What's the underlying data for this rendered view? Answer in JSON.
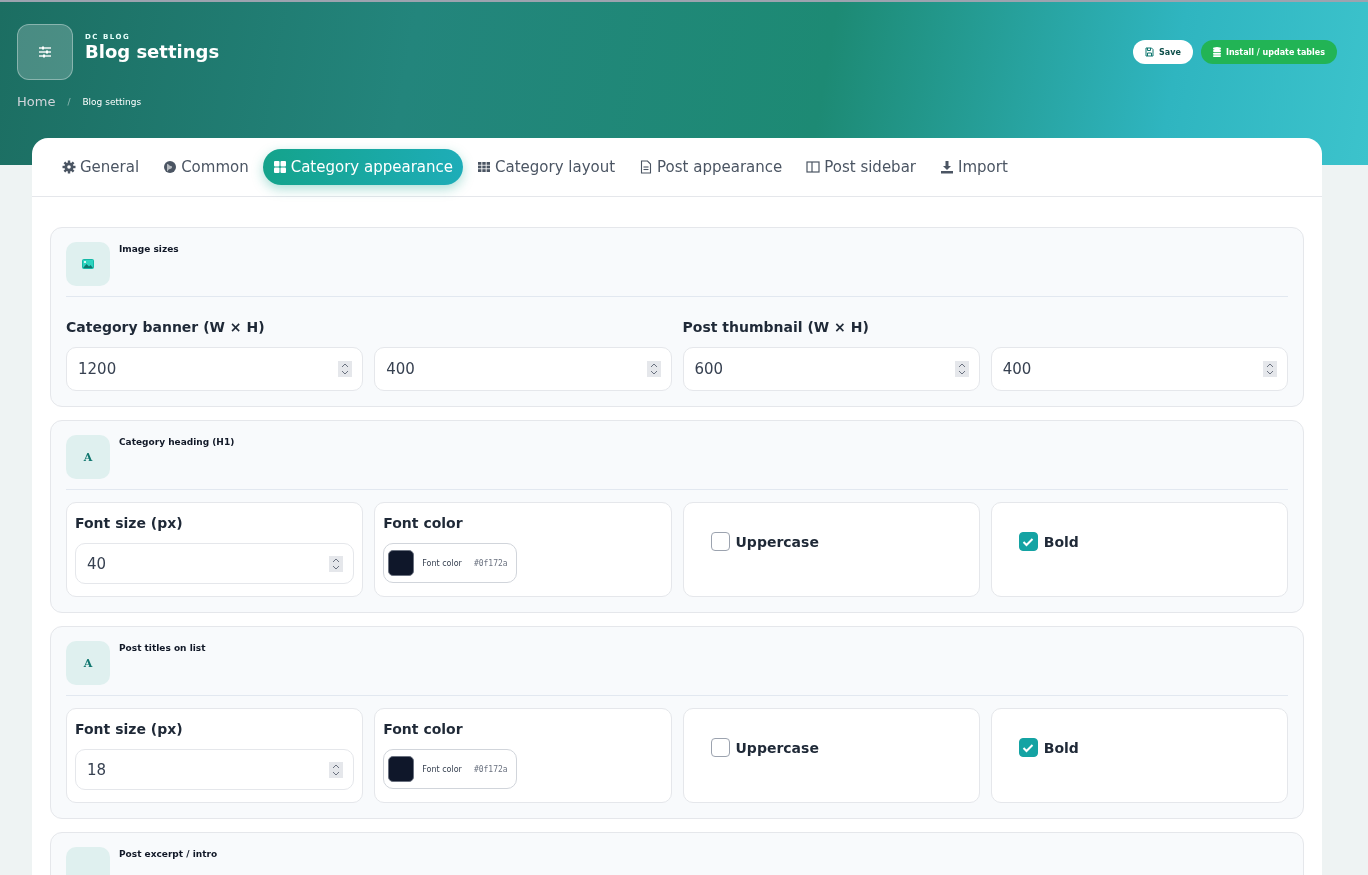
{
  "header": {
    "eyebrow": "DC BLOG",
    "title": "Blog settings",
    "breadcrumb": [
      "Home",
      "Blog settings"
    ],
    "breadcrumb_separator": "/",
    "buttons": [
      {
        "label": "Save",
        "kind": "save"
      },
      {
        "label": "Install / update tables",
        "kind": "install"
      }
    ]
  },
  "tabs": [
    {
      "label": "General",
      "selected": false
    },
    {
      "label": "Common",
      "selected": false
    },
    {
      "label": "Category appearance",
      "selected": true
    },
    {
      "label": "Category layout",
      "selected": false
    },
    {
      "label": "Post appearance",
      "selected": false
    },
    {
      "label": "Post sidebar",
      "selected": false
    },
    {
      "label": "Import",
      "selected": false
    }
  ],
  "sections": [
    {
      "kind": "sizes",
      "title": "Image sizes",
      "groups": [
        {
          "label": "Category banner (W × H)",
          "values": [
            "1200",
            "400"
          ]
        },
        {
          "label": "Post thumbnail (W × H)",
          "values": [
            "600",
            "400"
          ]
        }
      ]
    },
    {
      "kind": "typography",
      "icon_text": "A",
      "title": "Category heading (H1)",
      "font_size_label": "Font size (px)",
      "font_size": "40",
      "color_label": "Font color",
      "color_caption": "Font color",
      "color": "#0f172a",
      "color_value": "#0f172a",
      "uppercase_label": "Uppercase",
      "uppercase": false,
      "bold_label": "Bold",
      "bold": true
    },
    {
      "kind": "typography",
      "icon_text": "A",
      "title": "Post titles on list",
      "font_size_label": "Font size (px)",
      "font_size": "18",
      "color_label": "Font color",
      "color_caption": "Font color",
      "color": "#0f172a",
      "color_value": "#0f172a",
      "uppercase_label": "Uppercase",
      "uppercase": false,
      "bold_label": "Bold",
      "bold": true
    },
    {
      "kind": "partial",
      "title": "Post excerpt / intro"
    }
  ]
}
